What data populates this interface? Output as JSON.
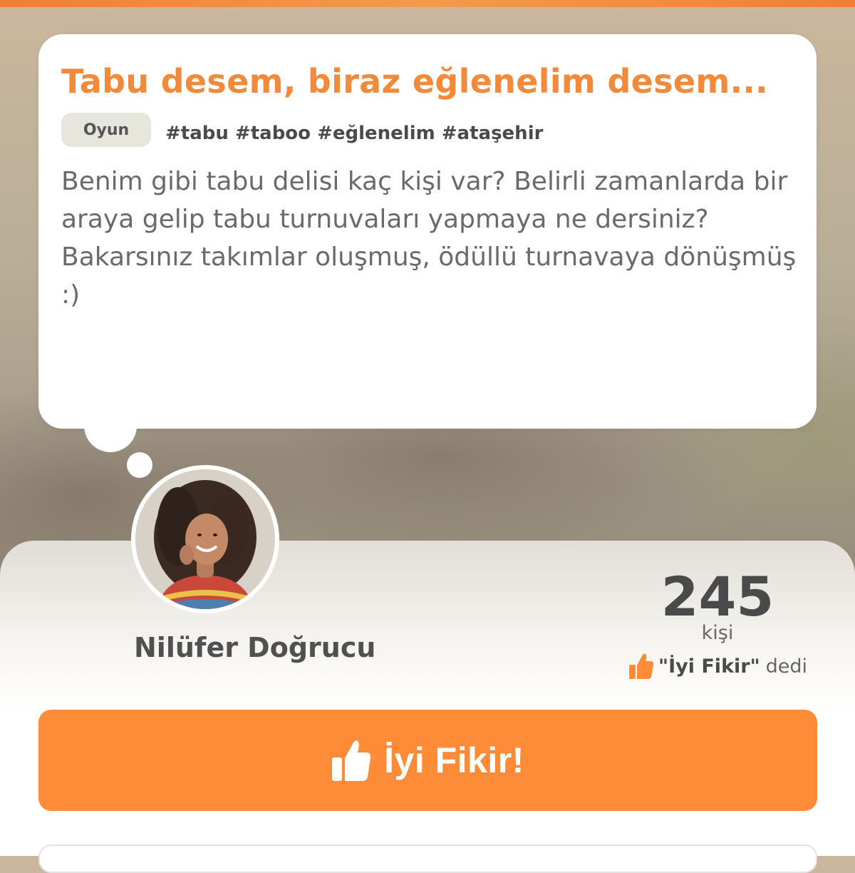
{
  "idea": {
    "title": "Tabu desem, biraz eğlenelim desem...",
    "category": "Oyun",
    "hashtags": "#tabu #taboo #eğlenelim #ataşehir",
    "description": "Benim gibi tabu delisi kaç kişi var? Belirli zamanlarda bir araya gelip tabu turnuvaları yapmaya ne dersiniz? Bakarsınız takımlar oluşmuş, ödüllü turnavaya dönüşmüş :)"
  },
  "author": {
    "name": "Nilüfer Doğrucu"
  },
  "likes": {
    "count": "245",
    "unit": "kişi",
    "quote": "\"İyi Fikir\"",
    "said": "dedi",
    "icon": "thumbs-up-icon"
  },
  "action": {
    "button_label": "İyi Fikir!",
    "icon": "thumbs-up-icon"
  },
  "colors": {
    "accent": "#fe8b37",
    "title": "#f28a3c"
  }
}
